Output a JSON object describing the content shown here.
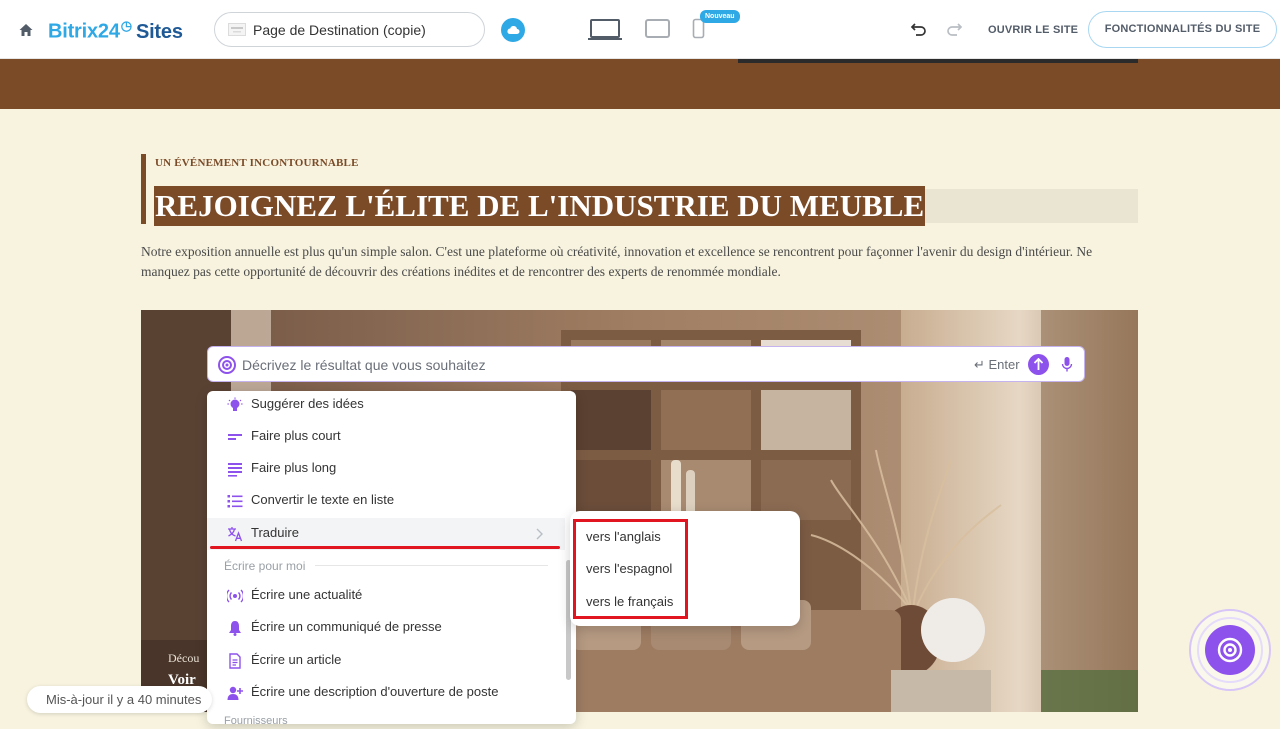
{
  "header": {
    "logo_b24": "Bitrix24",
    "logo_sites": "Sites",
    "page_name": "Page de Destination (copie)",
    "new_badge": "Nouveau",
    "open_site": "OUVRIR LE SITE",
    "site_features": "FONCTIONNALITÉS DU SITE"
  },
  "content": {
    "eyebrow": "UN ÉVÉNEMENT INCONTOURNABLE",
    "title": "REJOIGNEZ L'ÉLITE DE L'INDUSTRIE DU MEUBLE",
    "paragraph": "Notre exposition annuelle est plus qu'un simple salon. C'est une plateforme où créativité, innovation et excellence se rencontrent pour façonner l'avenir du design d'intérieur. Ne manquez pas cette opportunité de découvrir des créations inédites et de rencontrer des experts de renommée mondiale.",
    "hero_text1": "Décou",
    "hero_text2": "Voir"
  },
  "ai_prompt": {
    "placeholder": "Décrivez le résultat que vous souhaitez",
    "enter_label": "Enter"
  },
  "menu": {
    "items": [
      {
        "label": "Suggérer des idées",
        "icon": "lightbulb-icon"
      },
      {
        "label": "Faire plus court",
        "icon": "shorten-icon"
      },
      {
        "label": "Faire plus long",
        "icon": "lengthen-icon"
      },
      {
        "label": "Convertir le texte en liste",
        "icon": "list-icon"
      },
      {
        "label": "Traduire",
        "icon": "translate-icon"
      }
    ],
    "section_label": "Écrire pour moi",
    "write_items": [
      {
        "label": "Écrire une actualité",
        "icon": "broadcast-icon"
      },
      {
        "label": "Écrire un communiqué de presse",
        "icon": "bell-icon"
      },
      {
        "label": "Écrire un article",
        "icon": "document-icon"
      },
      {
        "label": "Écrire une description d'ouverture de poste",
        "icon": "add-user-icon"
      }
    ],
    "more_label": "Fournisseurs"
  },
  "submenu": {
    "items": [
      "vers l'anglais",
      "vers l'espagnol",
      "vers le français"
    ]
  },
  "status": {
    "updated": "Mis-à-jour il y a 40 minutes"
  },
  "colors": {
    "brand_blue": "#2fa8e6",
    "accent_purple": "#8e52ec",
    "brown": "#7b4a27",
    "cream": "#f7f3df",
    "highlight_red": "#e0151f"
  }
}
